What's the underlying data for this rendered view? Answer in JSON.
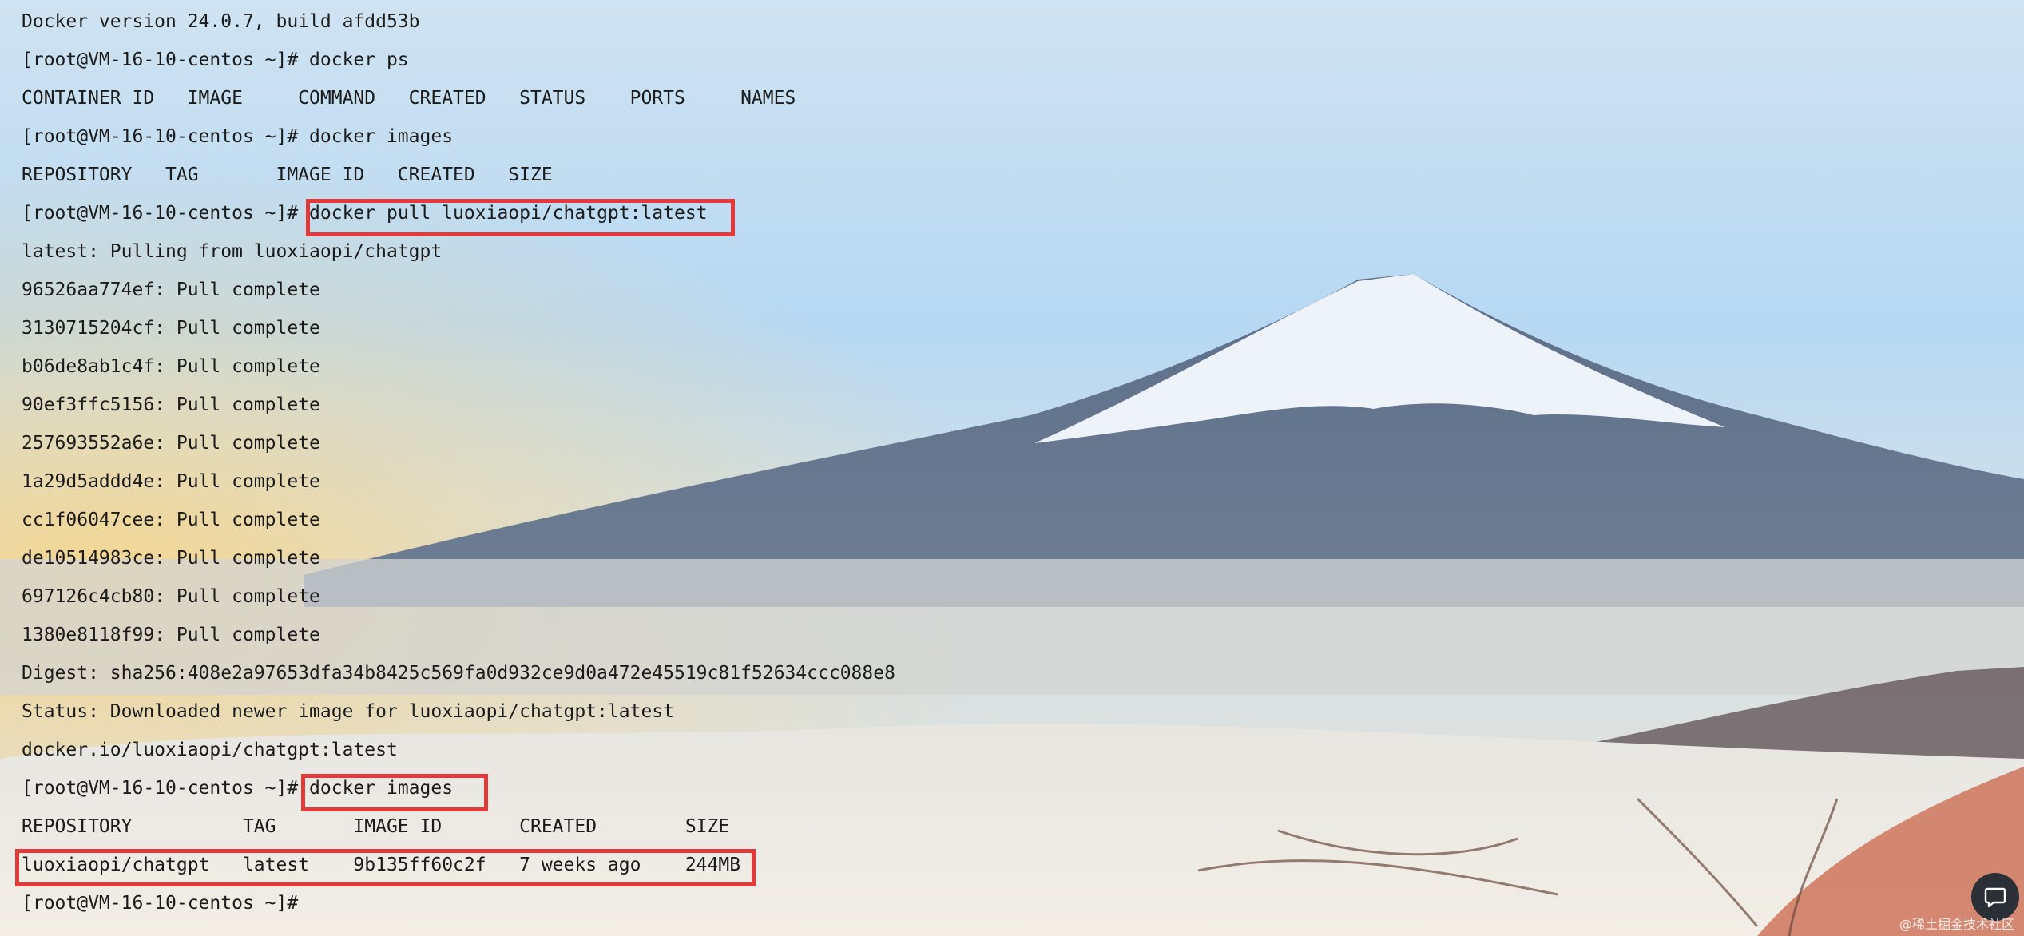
{
  "terminal": {
    "version_line": "Docker version 24.0.7, build afdd53b",
    "prompt": "[root@VM-16-10-centos ~]#",
    "cmd_ps": " docker ps",
    "ps_header": "CONTAINER ID   IMAGE     COMMAND   CREATED   STATUS    PORTS     NAMES",
    "cmd_images_1": " docker images",
    "images_header_1": "REPOSITORY   TAG       IMAGE ID   CREATED   SIZE",
    "cmd_pull": "docker pull luoxiaopi/chatgpt:latest",
    "pulling_from": "latest: Pulling from luoxiaopi/chatgpt",
    "layers": [
      "96526aa774ef: Pull complete",
      "3130715204cf: Pull complete",
      "b06de8ab1c4f: Pull complete",
      "90ef3ffc5156: Pull complete",
      "257693552a6e: Pull complete",
      "1a29d5addd4e: Pull complete",
      "cc1f06047cee: Pull complete",
      "de10514983ce: Pull complete",
      "697126c4cb80: Pull complete",
      "1380e8118f99: Pull complete"
    ],
    "digest": "Digest: sha256:408e2a97653dfa34b8425c569fa0d932ce9d0a472e45519c81f52634ccc088e8",
    "status": "Status: Downloaded newer image for luoxiaopi/chatgpt:latest",
    "image_ref": "docker.io/luoxiaopi/chatgpt:latest",
    "cmd_images_2": "docker images",
    "images_header_2": "REPOSITORY          TAG       IMAGE ID       CREATED        SIZE",
    "image_row": "luoxiaopi/chatgpt   latest    9b135ff60c2f   7 weeks ago    244MB"
  },
  "colors": {
    "highlight": "#e23a3a",
    "text": "#1b1b1b"
  },
  "chat_button_icon": "chat-bubble-icon",
  "watermark": "@稀土掘金技术社区"
}
